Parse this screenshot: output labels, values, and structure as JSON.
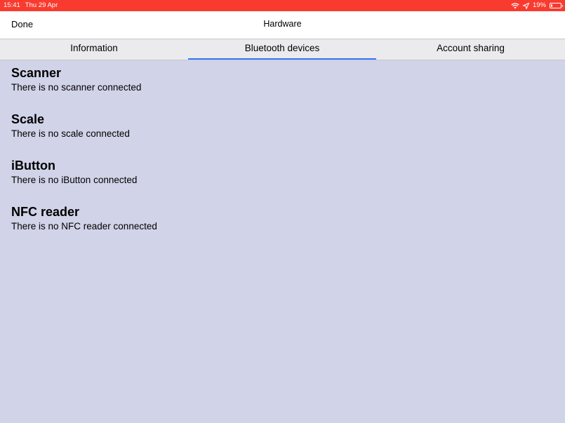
{
  "status_bar": {
    "time": "15:41",
    "date": "Thu 29 Apr",
    "battery": "19%",
    "battery_level": 0.19,
    "icons": [
      "wifi-icon",
      "location-icon",
      "battery-icon"
    ]
  },
  "nav": {
    "done_label": "Done",
    "title": "Hardware"
  },
  "tabs": [
    {
      "label": "Information",
      "selected": false
    },
    {
      "label": "Bluetooth devices",
      "selected": true
    },
    {
      "label": "Account sharing",
      "selected": false
    }
  ],
  "devices": [
    {
      "title": "Scanner",
      "status": "There is no scanner connected"
    },
    {
      "title": "Scale",
      "status": "There is no scale connected"
    },
    {
      "title": "iButton",
      "status": "There is no iButton connected"
    },
    {
      "title": "NFC reader",
      "status": "There is no NFC reader connected"
    }
  ],
  "colors": {
    "status_bar": "#f93b2f",
    "background": "#d1d3e8",
    "tab_bar": "#ebebee",
    "accent": "#3478f6"
  }
}
